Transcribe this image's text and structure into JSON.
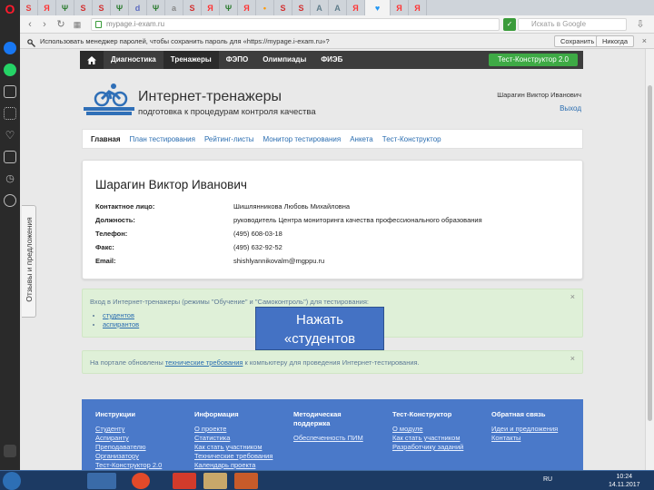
{
  "browser": {
    "url": "mypage.i-exam.ru",
    "search_placeholder": "Искать в Google",
    "tabs": [
      {
        "label": "S",
        "color": "#e83e3e"
      },
      {
        "label": "Я",
        "color": "#ff3333"
      },
      {
        "label": "Ψ",
        "color": "#2e7d32"
      },
      {
        "label": "S",
        "color": "#d32f2f"
      },
      {
        "label": "S",
        "color": "#d32f2f"
      },
      {
        "label": "Ψ",
        "color": "#2e7d32"
      },
      {
        "label": "d",
        "color": "#5c6bc0"
      },
      {
        "label": "Ψ",
        "color": "#2e7d32"
      },
      {
        "label": "а",
        "color": "#888888"
      },
      {
        "label": "S",
        "color": "#d32f2f"
      },
      {
        "label": "Я",
        "color": "#ff3333"
      },
      {
        "label": "Ψ",
        "color": "#2e7d32"
      },
      {
        "label": "Я",
        "color": "#ff3333"
      },
      {
        "label": "•",
        "color": "#ff9800"
      },
      {
        "label": "S",
        "color": "#d32f2f"
      },
      {
        "label": "S",
        "color": "#d32f2f"
      },
      {
        "label": "А",
        "color": "#607d8b"
      },
      {
        "label": "А",
        "color": "#607d8b"
      },
      {
        "label": "Я",
        "color": "#ff3333"
      },
      {
        "label": "♥",
        "color": "#2196f3"
      },
      {
        "label": "Я",
        "color": "#ff3333"
      },
      {
        "label": "Я",
        "color": "#ff3333"
      }
    ]
  },
  "password_bar": {
    "text": "Использовать менеджер паролей, чтобы сохранить пароль для «https://mypage.i-exam.ru»?",
    "save_label": "Сохранить",
    "never_label": "Никогда",
    "close_glyph": "×"
  },
  "feedback": {
    "label": "Отзывы и предложения"
  },
  "topnav": {
    "items": [
      "Диагностика",
      "Тренажеры",
      "ФЭПО",
      "Олимпиады",
      "ФИЭБ"
    ],
    "constructor_button": "Тест-Конструктор 2.0"
  },
  "header": {
    "title": "Интернет-тренажеры",
    "subtitle": "подготовка к процедурам контроля качества",
    "user_name": "Шарагин Виктор Иванович",
    "logout": "Выход"
  },
  "subnav": {
    "items": [
      "Главная",
      "План тестирования",
      "Рейтинг-листы",
      "Монитор тестирования",
      "Анкета",
      "Тест-Конструктор"
    ]
  },
  "profile": {
    "name": "Шарагин Виктор Иванович",
    "rows": [
      {
        "label": "Контактное лицо:",
        "value": "Шишлянникова Любовь Михайловна"
      },
      {
        "label": "Должность:",
        "value": "руководитель Центра мониторинга качества профессионального образования"
      },
      {
        "label": "Телефон:",
        "value": "(495) 608-03-18"
      },
      {
        "label": "Факс:",
        "value": "(495) 632-92-52"
      },
      {
        "label": "Email:",
        "value": "shishlyannikovalm@mgppu.ru"
      }
    ]
  },
  "alert1": {
    "text": "Вход в Интернет-тренажеры (режимы \"Обучение\" и \"Самоконтроль\") для тестирования:",
    "links": [
      "студентов",
      "аспирантов"
    ],
    "close": "×"
  },
  "alert2": {
    "text_before": "На портале обновлены ",
    "link": "технические требования",
    "text_after": " к компьютеру для проведения Интернет-тестирования.",
    "close": "×"
  },
  "callout": {
    "line1": "Нажать",
    "line2": "«студентов"
  },
  "footer": {
    "columns": [
      {
        "heading": "Инструкции",
        "links": [
          "Студенту",
          "Аспиранту",
          "Преподавателю",
          "Организатору",
          "Тест-Конструктор 2.0"
        ]
      },
      {
        "heading": "Информация",
        "links": [
          "О проекте",
          "Статистика",
          "Как стать участником",
          "Технические требования",
          "Календарь проекта"
        ]
      },
      {
        "heading": "Методическая поддержка",
        "links": [
          "Обеспеченность ПИМ"
        ]
      },
      {
        "heading": "Тест-Конструктор",
        "links": [
          "О модуле",
          "Как стать участником",
          "Разработчику заданий"
        ]
      },
      {
        "heading": "Обратная связь",
        "links": [
          "Идеи и предложения",
          "Контакты"
        ]
      }
    ]
  },
  "taskbar": {
    "lang": "RU",
    "time": "10:24",
    "date": "14.11.2017"
  }
}
